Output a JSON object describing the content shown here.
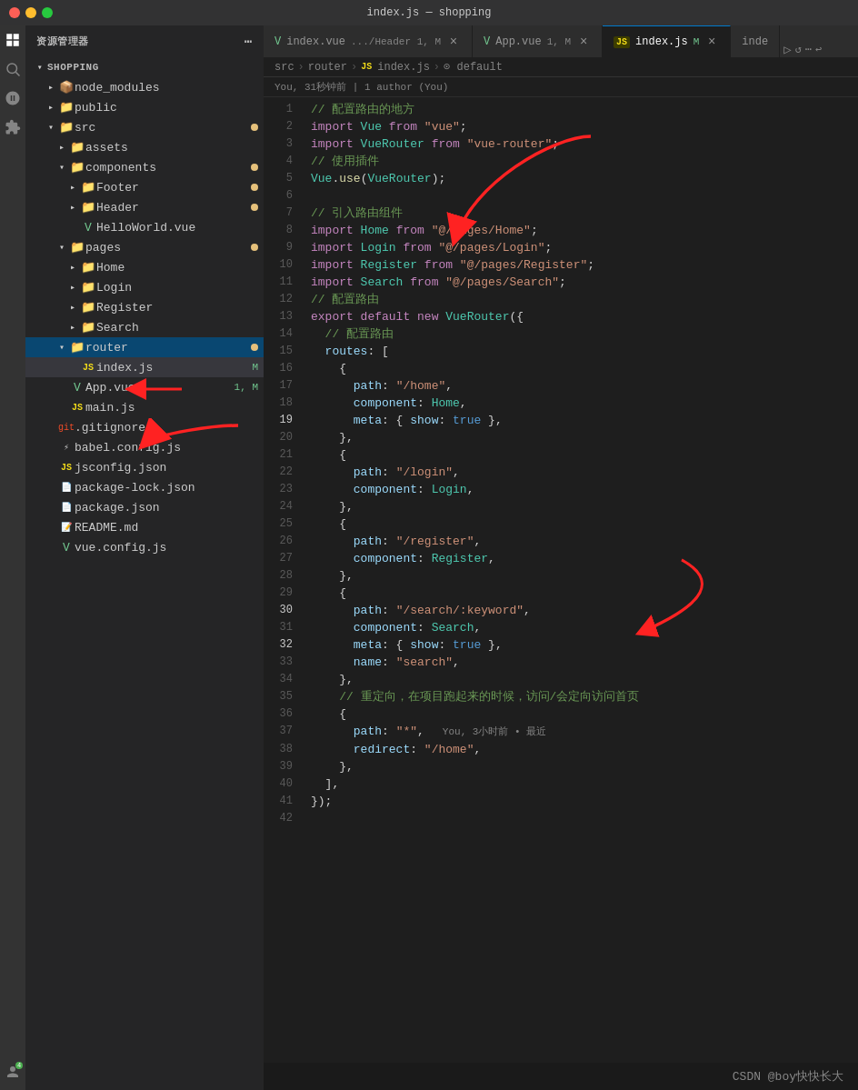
{
  "titlebar": {
    "title": "index.js — shopping"
  },
  "sidebar": {
    "header": "资源管理器",
    "root": "SHOPPING",
    "items": [
      {
        "id": "node_modules",
        "label": "node_modules",
        "indent": 1,
        "type": "folder",
        "collapsed": true
      },
      {
        "id": "public",
        "label": "public",
        "indent": 1,
        "type": "folder",
        "collapsed": true
      },
      {
        "id": "src",
        "label": "src",
        "indent": 1,
        "type": "folder",
        "collapsed": false,
        "badge": true
      },
      {
        "id": "assets",
        "label": "assets",
        "indent": 2,
        "type": "folder",
        "collapsed": true
      },
      {
        "id": "components",
        "label": "components",
        "indent": 2,
        "type": "folder",
        "collapsed": false,
        "badge": true
      },
      {
        "id": "Footer",
        "label": "Footer",
        "indent": 3,
        "type": "folder",
        "collapsed": true,
        "badge": true
      },
      {
        "id": "Header",
        "label": "Header",
        "indent": 3,
        "type": "folder",
        "collapsed": true,
        "badge": true
      },
      {
        "id": "HelloWorld.vue",
        "label": "HelloWorld.vue",
        "indent": 3,
        "type": "vue"
      },
      {
        "id": "pages",
        "label": "pages",
        "indent": 2,
        "type": "folder",
        "collapsed": false,
        "badge": true
      },
      {
        "id": "Home",
        "label": "Home",
        "indent": 3,
        "type": "folder",
        "collapsed": true
      },
      {
        "id": "Login",
        "label": "Login",
        "indent": 3,
        "type": "folder",
        "collapsed": true
      },
      {
        "id": "Register",
        "label": "Register",
        "indent": 3,
        "type": "folder",
        "collapsed": true
      },
      {
        "id": "Search",
        "label": "Search",
        "indent": 3,
        "type": "folder",
        "collapsed": true
      },
      {
        "id": "router",
        "label": "router",
        "indent": 2,
        "type": "folder",
        "collapsed": false,
        "badge": true,
        "active": true
      },
      {
        "id": "index.js",
        "label": "index.js",
        "indent": 3,
        "type": "js",
        "badge": "M",
        "selected": true
      },
      {
        "id": "App.vue",
        "label": "App.vue",
        "indent": 2,
        "type": "vue",
        "badge": "1, M"
      },
      {
        "id": "main.js",
        "label": "main.js",
        "indent": 2,
        "type": "js"
      },
      {
        "id": ".gitignore",
        "label": ".gitignore",
        "indent": 1,
        "type": "git"
      },
      {
        "id": "babel.config.js",
        "label": "babel.config.js",
        "indent": 1,
        "type": "babel"
      },
      {
        "id": "jsconfig.json",
        "label": "jsconfig.json",
        "indent": 1,
        "type": "json"
      },
      {
        "id": "package-lock.json",
        "label": "package-lock.json",
        "indent": 1,
        "type": "json"
      },
      {
        "id": "package.json",
        "label": "package.json",
        "indent": 1,
        "type": "json"
      },
      {
        "id": "README.md",
        "label": "README.md",
        "indent": 1,
        "type": "md"
      },
      {
        "id": "vue.config.js",
        "label": "vue.config.js",
        "indent": 1,
        "type": "vue2"
      }
    ]
  },
  "tabs": [
    {
      "id": "index-vue-header",
      "label": "index.vue",
      "sub": ".../Header 1, M",
      "type": "vue",
      "active": false
    },
    {
      "id": "app-vue",
      "label": "App.vue",
      "sub": "1, M",
      "type": "vue",
      "active": false
    },
    {
      "id": "index-js",
      "label": "index.js",
      "sub": "M",
      "type": "js",
      "active": true
    },
    {
      "id": "inde-partial",
      "label": "inde",
      "type": "tab-partial",
      "active": false
    }
  ],
  "breadcrumb": {
    "parts": [
      "src",
      "router",
      "JS index.js",
      "⊙ default"
    ]
  },
  "git_info": "You, 31秒钟前 | 1 author (You)",
  "code_lines": [
    {
      "num": 1,
      "content": "// 配置路由的地方",
      "type": "comment"
    },
    {
      "num": 2,
      "content": "import Vue from \"vue\";",
      "tokens": [
        {
          "t": "import",
          "c": "c-import"
        },
        {
          "t": " Vue ",
          "c": "c-class"
        },
        {
          "t": "from",
          "c": "c-import"
        },
        {
          "t": " \"vue\"",
          "c": "c-string"
        },
        {
          "t": ";",
          "c": "c-plain"
        }
      ]
    },
    {
      "num": 3,
      "content": "import VueRouter from \"vue-router\";",
      "tokens": [
        {
          "t": "import",
          "c": "c-import"
        },
        {
          "t": " VueRouter ",
          "c": "c-class"
        },
        {
          "t": "from",
          "c": "c-import"
        },
        {
          "t": " \"vue-router\"",
          "c": "c-string"
        },
        {
          "t": ";",
          "c": "c-plain"
        }
      ]
    },
    {
      "num": 4,
      "content": "// 使用插件",
      "type": "comment"
    },
    {
      "num": 5,
      "content": "Vue.use(VueRouter);",
      "tokens": [
        {
          "t": "Vue",
          "c": "c-class"
        },
        {
          "t": ".",
          "c": "c-plain"
        },
        {
          "t": "use",
          "c": "c-function"
        },
        {
          "t": "(",
          "c": "c-plain"
        },
        {
          "t": "VueRouter",
          "c": "c-class"
        },
        {
          "t": ");",
          "c": "c-plain"
        }
      ]
    },
    {
      "num": 6,
      "content": ""
    },
    {
      "num": 7,
      "content": "// 引入路由组件",
      "type": "comment"
    },
    {
      "num": 8,
      "content": "import Home from \"@/pages/Home\";",
      "tokens": [
        {
          "t": "import",
          "c": "c-import"
        },
        {
          "t": " Home ",
          "c": "c-class"
        },
        {
          "t": "from",
          "c": "c-import"
        },
        {
          "t": " \"@/pages/Home\"",
          "c": "c-string"
        },
        {
          "t": ";",
          "c": "c-plain"
        }
      ]
    },
    {
      "num": 9,
      "content": "import Login from \"@/pages/Login\";",
      "tokens": [
        {
          "t": "import",
          "c": "c-import"
        },
        {
          "t": " Login ",
          "c": "c-class"
        },
        {
          "t": "from",
          "c": "c-import"
        },
        {
          "t": " \"@/pages/Login\"",
          "c": "c-string"
        },
        {
          "t": ";",
          "c": "c-plain"
        }
      ]
    },
    {
      "num": 10,
      "content": "import Register from \"@/pages/Register\";",
      "tokens": [
        {
          "t": "import",
          "c": "c-import"
        },
        {
          "t": " Register ",
          "c": "c-class"
        },
        {
          "t": "from",
          "c": "c-import"
        },
        {
          "t": " \"@/pages/Register\"",
          "c": "c-string"
        },
        {
          "t": ";",
          "c": "c-plain"
        }
      ]
    },
    {
      "num": 11,
      "content": "import Search from \"@/pages/Search\";",
      "tokens": [
        {
          "t": "import",
          "c": "c-import"
        },
        {
          "t": " Search ",
          "c": "c-class"
        },
        {
          "t": "from",
          "c": "c-import"
        },
        {
          "t": " \"@/pages/Search\"",
          "c": "c-string"
        },
        {
          "t": ";",
          "c": "c-plain"
        }
      ]
    },
    {
      "num": 12,
      "content": "// 配置路由",
      "type": "comment"
    },
    {
      "num": 13,
      "content": "export default new VueRouter({",
      "tokens": [
        {
          "t": "export",
          "c": "c-import"
        },
        {
          "t": " default ",
          "c": "c-keyword"
        },
        {
          "t": "new",
          "c": "c-keyword"
        },
        {
          "t": " VueRouter",
          "c": "c-class"
        },
        {
          "t": "({",
          "c": "c-plain"
        }
      ]
    },
    {
      "num": 14,
      "content": "  // 配置路由",
      "type": "comment_indent"
    },
    {
      "num": 15,
      "content": "  routes: [",
      "tokens": [
        {
          "t": "  routes",
          "c": "c-property"
        },
        {
          "t": ": [",
          "c": "c-plain"
        }
      ]
    },
    {
      "num": 16,
      "content": "    {",
      "tokens": [
        {
          "t": "    {",
          "c": "c-plain"
        }
      ]
    },
    {
      "num": 17,
      "content": "      path: \"/home\",",
      "tokens": [
        {
          "t": "      path",
          "c": "c-property"
        },
        {
          "t": ": ",
          "c": "c-plain"
        },
        {
          "t": "\"/home\"",
          "c": "c-string"
        },
        {
          "t": ",",
          "c": "c-plain"
        }
      ]
    },
    {
      "num": 18,
      "content": "      component: Home,",
      "tokens": [
        {
          "t": "      component",
          "c": "c-property"
        },
        {
          "t": ": ",
          "c": "c-plain"
        },
        {
          "t": "Home",
          "c": "c-class"
        },
        {
          "t": ",",
          "c": "c-plain"
        }
      ]
    },
    {
      "num": 19,
      "content": "      meta: { show: true },",
      "tokens": [
        {
          "t": "      meta",
          "c": "c-property"
        },
        {
          "t": ": { ",
          "c": "c-plain"
        },
        {
          "t": "show",
          "c": "c-property"
        },
        {
          "t": ": ",
          "c": "c-plain"
        },
        {
          "t": "true",
          "c": "c-blue"
        },
        {
          "t": " },",
          "c": "c-plain"
        }
      ],
      "marker": true
    },
    {
      "num": 20,
      "content": "    },",
      "tokens": [
        {
          "t": "    },",
          "c": "c-plain"
        }
      ]
    },
    {
      "num": 21,
      "content": "    {",
      "tokens": [
        {
          "t": "    {",
          "c": "c-plain"
        }
      ]
    },
    {
      "num": 22,
      "content": "      path: \"/login\",",
      "tokens": [
        {
          "t": "      path",
          "c": "c-property"
        },
        {
          "t": ": ",
          "c": "c-plain"
        },
        {
          "t": "\"/login\"",
          "c": "c-string"
        },
        {
          "t": ",",
          "c": "c-plain"
        }
      ]
    },
    {
      "num": 23,
      "content": "      component: Login,",
      "tokens": [
        {
          "t": "      component",
          "c": "c-property"
        },
        {
          "t": ": ",
          "c": "c-plain"
        },
        {
          "t": "Login",
          "c": "c-class"
        },
        {
          "t": ",",
          "c": "c-plain"
        }
      ]
    },
    {
      "num": 24,
      "content": "    },",
      "tokens": [
        {
          "t": "    },",
          "c": "c-plain"
        }
      ]
    },
    {
      "num": 25,
      "content": "    {",
      "tokens": [
        {
          "t": "    {",
          "c": "c-plain"
        }
      ]
    },
    {
      "num": 26,
      "content": "      path: \"/register\",",
      "tokens": [
        {
          "t": "      path",
          "c": "c-property"
        },
        {
          "t": ": ",
          "c": "c-plain"
        },
        {
          "t": "\"/register\"",
          "c": "c-string"
        },
        {
          "t": ",",
          "c": "c-plain"
        }
      ]
    },
    {
      "num": 27,
      "content": "      component: Register,",
      "tokens": [
        {
          "t": "      component",
          "c": "c-property"
        },
        {
          "t": ": ",
          "c": "c-plain"
        },
        {
          "t": "Register",
          "c": "c-class"
        },
        {
          "t": ",",
          "c": "c-plain"
        }
      ]
    },
    {
      "num": 28,
      "content": "    },",
      "tokens": [
        {
          "t": "    },",
          "c": "c-plain"
        }
      ]
    },
    {
      "num": 29,
      "content": "    {",
      "tokens": [
        {
          "t": "    {",
          "c": "c-plain"
        }
      ]
    },
    {
      "num": 30,
      "content": "      path: \"/search/:keyword\",",
      "tokens": [
        {
          "t": "      path",
          "c": "c-property"
        },
        {
          "t": ": ",
          "c": "c-plain"
        },
        {
          "t": "\"/search/:keyword\"",
          "c": "c-string"
        },
        {
          "t": ",",
          "c": "c-plain"
        }
      ],
      "marker": true
    },
    {
      "num": 31,
      "content": "      component: Search,",
      "tokens": [
        {
          "t": "      component",
          "c": "c-property"
        },
        {
          "t": ": ",
          "c": "c-plain"
        },
        {
          "t": "Search",
          "c": "c-class"
        },
        {
          "t": ",",
          "c": "c-plain"
        }
      ]
    },
    {
      "num": 32,
      "content": "      meta: { show: true },",
      "tokens": [
        {
          "t": "      meta",
          "c": "c-property"
        },
        {
          "t": ": { ",
          "c": "c-plain"
        },
        {
          "t": "show",
          "c": "c-property"
        },
        {
          "t": ": ",
          "c": "c-plain"
        },
        {
          "t": "true",
          "c": "c-blue"
        },
        {
          "t": " },",
          "c": "c-plain"
        }
      ],
      "marker": true
    },
    {
      "num": 33,
      "content": "      name: \"search\",",
      "tokens": [
        {
          "t": "      name",
          "c": "c-property"
        },
        {
          "t": ": ",
          "c": "c-plain"
        },
        {
          "t": "\"search\"",
          "c": "c-string"
        },
        {
          "t": ",",
          "c": "c-plain"
        }
      ]
    },
    {
      "num": 34,
      "content": "    },",
      "tokens": [
        {
          "t": "    },",
          "c": "c-plain"
        }
      ]
    },
    {
      "num": 35,
      "content": "    // 重定向，在项目跑起来的时候，访问/会定向访问首页",
      "type": "comment"
    },
    {
      "num": 36,
      "content": "    {",
      "tokens": [
        {
          "t": "    {",
          "c": "c-plain"
        }
      ]
    },
    {
      "num": 37,
      "content": "      path: \"*\",",
      "tokens": [
        {
          "t": "      path",
          "c": "c-property"
        },
        {
          "t": ": ",
          "c": "c-plain"
        },
        {
          "t": "\"*\"",
          "c": "c-string"
        },
        {
          "t": ",",
          "c": "c-plain"
        }
      ],
      "git_inline": "You, 3小时前 • 最近"
    },
    {
      "num": 38,
      "content": "      redirect: \"/home\",",
      "tokens": [
        {
          "t": "      redirect",
          "c": "c-property"
        },
        {
          "t": ": ",
          "c": "c-plain"
        },
        {
          "t": "\"/home\"",
          "c": "c-string"
        },
        {
          "t": ",",
          "c": "c-plain"
        }
      ]
    },
    {
      "num": 39,
      "content": "    },",
      "tokens": [
        {
          "t": "    },",
          "c": "c-plain"
        }
      ]
    },
    {
      "num": 40,
      "content": "  ],",
      "tokens": [
        {
          "t": "  ],",
          "c": "c-plain"
        }
      ]
    },
    {
      "num": 41,
      "content": "});",
      "tokens": [
        {
          "t": "});",
          "c": "c-plain"
        }
      ]
    },
    {
      "num": 42,
      "content": ""
    }
  ],
  "watermark": "CSDN @boy快快长大"
}
